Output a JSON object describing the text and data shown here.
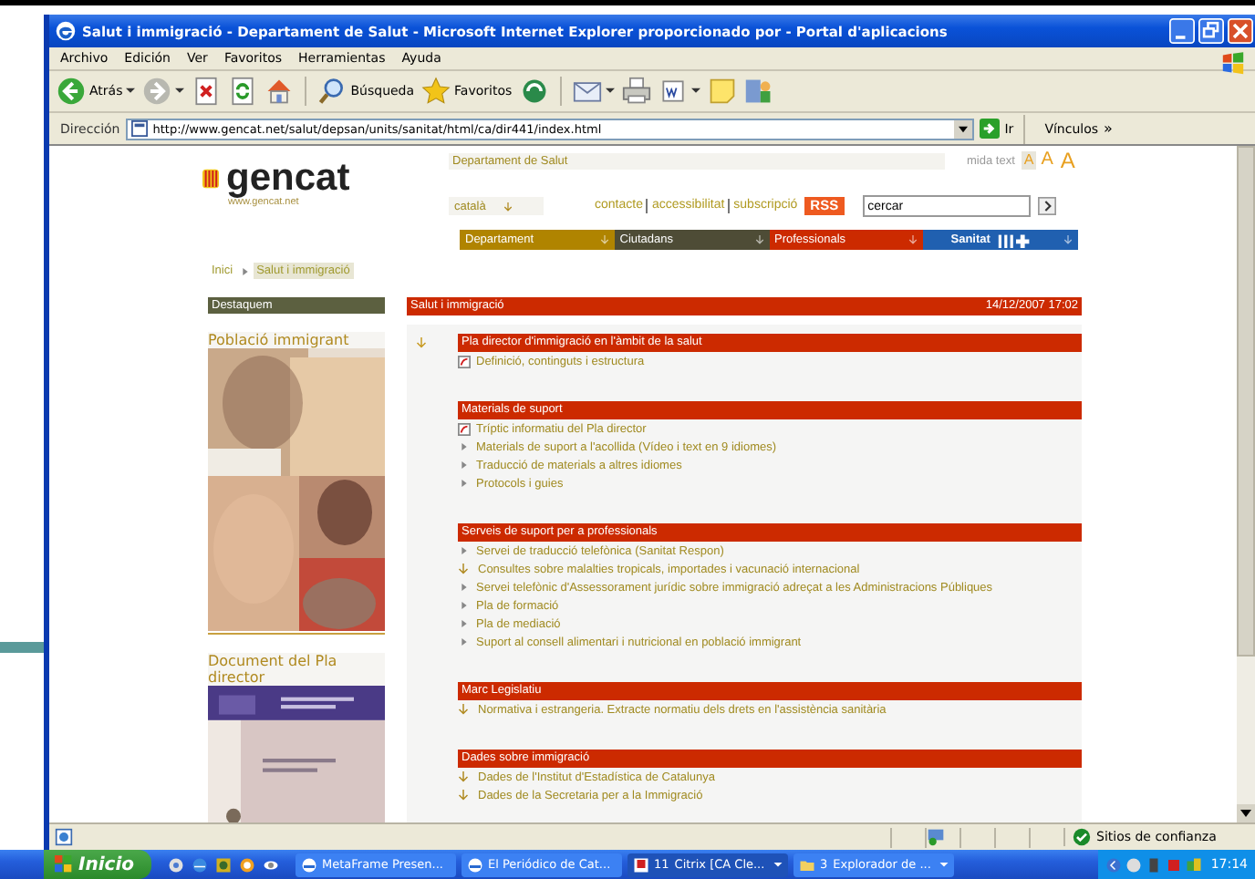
{
  "window": {
    "title": "Salut i immigració - Departament de Salut - Microsoft Internet Explorer proporcionado por  - Portal d'aplicacions"
  },
  "menu": [
    "Archivo",
    "Edición",
    "Ver",
    "Favoritos",
    "Herramientas",
    "Ayuda"
  ],
  "toolbar": [
    {
      "kind": "back",
      "label": "Atrás"
    },
    {
      "kind": "forward"
    },
    {
      "kind": "stop"
    },
    {
      "kind": "refresh"
    },
    {
      "kind": "home"
    },
    {
      "kind": "separator"
    },
    {
      "kind": "search",
      "label": "Búsqueda"
    },
    {
      "kind": "favorites",
      "label": "Favoritos"
    },
    {
      "kind": "media"
    },
    {
      "kind": "separator"
    },
    {
      "kind": "mail"
    },
    {
      "kind": "print"
    },
    {
      "kind": "edit"
    },
    {
      "kind": "note"
    },
    {
      "kind": "messenger"
    }
  ],
  "address": {
    "label": "Dirección",
    "url": "http://www.gencat.net/salut/depsan/units/sanitat/html/ca/dir441/index.html",
    "go": "Ir",
    "links": "Vínculos",
    "more": "»"
  },
  "page": {
    "header": {
      "logo": "gencat",
      "site": "www.gencat.net",
      "department": "Departament de Salut",
      "text_size_label": "mida text",
      "text_sizes": [
        {
          "label": "A",
          "selected": true
        },
        {
          "label": "A",
          "selected": false
        },
        {
          "label": "A",
          "selected": false
        }
      ],
      "language": "català",
      "links": [
        "contacte",
        "accessibilitat",
        "subscripció"
      ],
      "rss": "RSS",
      "search": {
        "value": "cercar"
      }
    },
    "nav": [
      {
        "label": "Departament",
        "color": "#b08400"
      },
      {
        "label": "Ciutadans",
        "color": "#4e4c36"
      },
      {
        "label": "Professionals",
        "color": "#cc2a00"
      },
      {
        "label": "Sanitat",
        "color": "#2060b0"
      }
    ],
    "breadcrumb": [
      {
        "label": "Inici",
        "selected": false
      },
      {
        "label": "Salut i immigració",
        "selected": true
      }
    ],
    "sidebar": {
      "title": "Destaquem",
      "blocks": [
        {
          "title": "Població immigrant",
          "kind": "picture"
        },
        {
          "title": "Document del Pla director",
          "kind": "picture"
        }
      ]
    },
    "main": {
      "title": "Salut i immigració",
      "date": "14/12/2007 17:02",
      "sections": [
        {
          "title": "Pla director d'immigració en l'àmbit de la salut",
          "items": [
            {
              "kind": "pdf",
              "text": "Definició, continguts i estructura"
            }
          ]
        },
        {
          "title": "Materials de suport",
          "items": [
            {
              "kind": "pdf",
              "text": "Tríptic informatiu del Pla director"
            },
            {
              "kind": "link",
              "text": "Materials de suport a l'acollida (Vídeo i text en 9 idiomes)"
            },
            {
              "kind": "link",
              "text": "Traducció de materials a altres idiomes"
            },
            {
              "kind": "link",
              "text": "Protocols i guies"
            }
          ]
        },
        {
          "title": "Serveis de suport per a professionals",
          "items": [
            {
              "kind": "link",
              "text": "Servei de traducció telefònica (Sanitat Respon)"
            },
            {
              "kind": "download",
              "text": "Consultes sobre malalties tropicals, importades i vacunació internacional"
            },
            {
              "kind": "link",
              "text": "Servei telefònic d'Assessorament jurídic sobre immigració adreçat a les Administracions Públiques"
            },
            {
              "kind": "link",
              "text": "Pla de formació"
            },
            {
              "kind": "link",
              "text": "Pla de mediació"
            },
            {
              "kind": "link",
              "text": "Suport al consell alimentari i nutricional en població immigrant"
            }
          ]
        },
        {
          "title": "Marc Legislatiu",
          "items": [
            {
              "kind": "download",
              "text": "Normativa i estrangeria. Extracte normatiu dels drets en l'assistència sanitària"
            }
          ]
        },
        {
          "title": "Dades sobre immigració",
          "items": [
            {
              "kind": "download",
              "text": "Dades de l'Institut d'Estadística de Catalunya"
            },
            {
              "kind": "download",
              "text": "Dades de la Secretaria per a la Immigració"
            }
          ]
        }
      ]
    }
  },
  "status_bar": {
    "zone": "Sitios de confianza"
  },
  "taskbar": {
    "start": "Inicio",
    "tasks": [
      {
        "label": "MetaFrame Presen...",
        "selected": false,
        "kind": "ie"
      },
      {
        "label": "El Periódico de Cat...",
        "selected": false,
        "kind": "ie"
      },
      {
        "count": "11",
        "label": "Citrix [CA Cle...",
        "selected": true,
        "kind": "citrix"
      },
      {
        "count": "3",
        "label": "Explorador de ...",
        "selected": false,
        "kind": "folder"
      }
    ],
    "clock": "17:14"
  }
}
